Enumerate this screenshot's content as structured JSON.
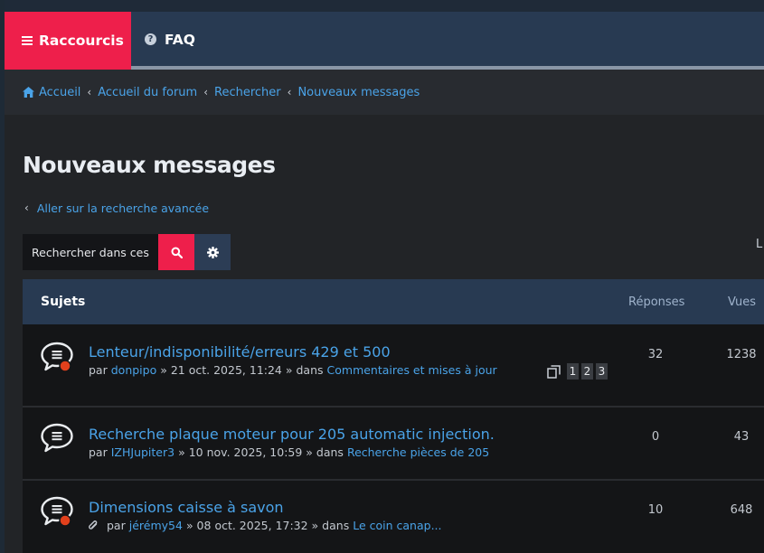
{
  "nav": {
    "raccourcis_label": "Raccourcis",
    "faq_label": "FAQ"
  },
  "breadcrumb": {
    "items": [
      "Accueil",
      "Accueil du forum",
      "Rechercher",
      "Nouveaux messages"
    ]
  },
  "page": {
    "title": "Nouveaux messages",
    "advanced_search_link": "Aller sur la recherche avancée",
    "edge_text": "L"
  },
  "search": {
    "value": "Rechercher dans ces"
  },
  "table": {
    "headers": {
      "topics": "Sujets",
      "replies": "Réponses",
      "views": "Vues"
    },
    "rows": [
      {
        "title": "Lenteur/indisponibilité/erreurs 429 et 500",
        "by_prefix": "par",
        "author": "donpipo",
        "date_text": "» 21 oct. 2025, 11:24 » dans",
        "forum": "Commentaires et mises à jour",
        "replies": "32",
        "views": "1238",
        "pages": [
          "1",
          "2",
          "3"
        ],
        "unread": true,
        "attachment": false
      },
      {
        "title": "Recherche plaque moteur pour 205 automatic injection.",
        "by_prefix": "par",
        "author": "IZHJupiter3",
        "date_text": "» 10 nov. 2025, 10:59 » dans",
        "forum": "Recherche pièces de 205",
        "replies": "0",
        "views": "43",
        "pages": [],
        "unread": false,
        "attachment": false
      },
      {
        "title": "Dimensions caisse à savon",
        "by_prefix": "par",
        "author": "jérémy54",
        "date_text": "» 08 oct. 2025, 17:32 » dans",
        "forum": "Le coin canap...",
        "replies": "10",
        "views": "648",
        "pages": [],
        "unread": true,
        "attachment": true
      }
    ]
  },
  "colors": {
    "accent_red": "#ee1f4b",
    "nav_blue": "#283a52",
    "link_blue": "#4aa3e8",
    "unread_dot": "#e2401c"
  }
}
